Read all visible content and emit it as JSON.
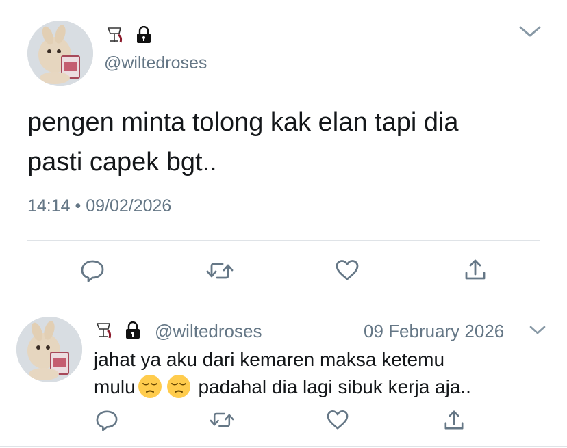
{
  "main_tweet": {
    "display_name": "🍷",
    "handle": "@wiltedroses",
    "text_line1": "pengen minta tolong kak elan tapi dia",
    "text_line2": "pasti capek bgt..",
    "timestamp": "14:14 • 09/02/2026",
    "icons": [
      "wine-glass-icon",
      "lock-icon",
      "chevron-down-icon",
      "reply-icon",
      "retweet-icon",
      "like-icon",
      "share-icon"
    ]
  },
  "reply_tweet": {
    "display_name": "🍷",
    "handle": "@wiltedroses",
    "date": "09 February 2026",
    "text_line1": "jahat ya aku dari kemaren maksa ketemu",
    "text_line2_a": "mulu",
    "emoji": [
      "pensive-face-emoji",
      "pensive-face-emoji"
    ],
    "text_line2_b": " padahal dia lagi sibuk kerja aja..",
    "icons": [
      "wine-glass-icon",
      "lock-icon",
      "chevron-down-icon",
      "reply-icon",
      "retweet-icon",
      "like-icon",
      "share-icon"
    ]
  },
  "colors": {
    "text": "#14171a",
    "secondary": "#657786",
    "divider": "#dfe3e7",
    "icon": "#657786"
  }
}
